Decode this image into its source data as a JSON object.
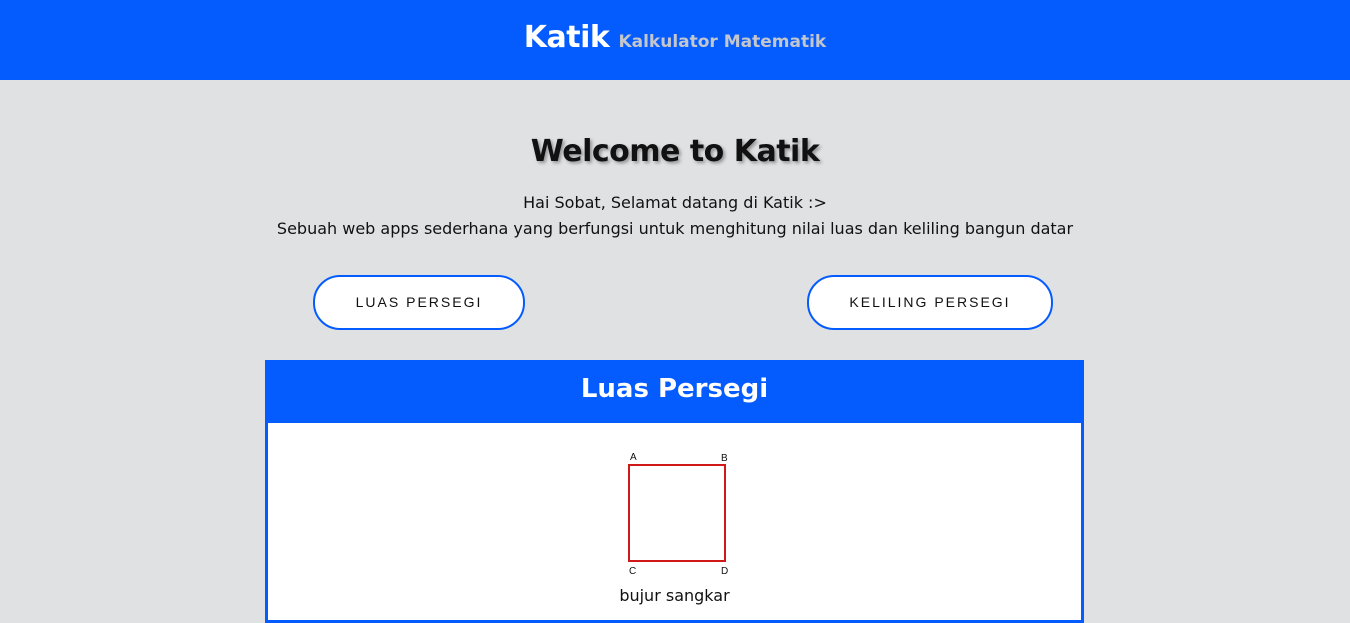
{
  "header": {
    "brand_name": "Katik",
    "tagline": "Kalkulator Matematik"
  },
  "welcome": {
    "title": "Welcome to Katik",
    "line1": "Hai Sobat, Selamat datang di Katik :>",
    "line2": "Sebuah web apps sederhana yang berfungsi untuk menghitung nilai luas dan keliling bangun datar"
  },
  "buttons": {
    "luas_label": "LUAS PERSEGI",
    "keliling_label": "KELILING PERSEGI"
  },
  "panel": {
    "title": "Luas Persegi",
    "corner_a": "A",
    "corner_b": "B",
    "corner_c": "C",
    "corner_d": "D",
    "caption": "bujur sangkar"
  },
  "colors": {
    "brand_blue": "#045cff",
    "background": "#e0e1e3",
    "square_stroke": "#d01818"
  }
}
